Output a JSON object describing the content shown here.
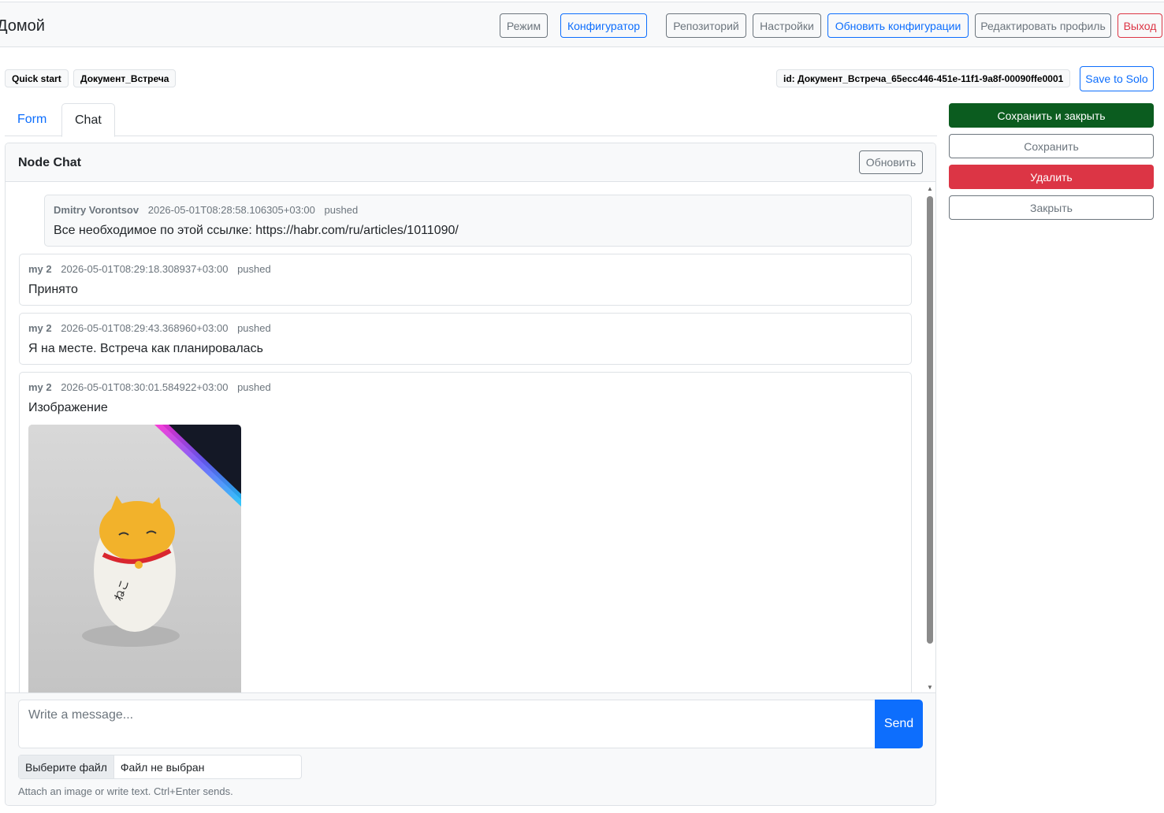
{
  "topbar": {
    "brand": "Домой",
    "buttons": {
      "mode": "Режим",
      "configurator": "Конфигуратор",
      "repository": "Репозиторий",
      "settings": "Настройки",
      "update_configs": "Обновить конфигурации",
      "edit_profile": "Редактировать профиль",
      "logout": "Выход"
    }
  },
  "breadcrumbs": {
    "quick_start": "Quick start",
    "document": "Документ_Встреча",
    "id": "id: Документ_Встреча_65ecc446-451e-11f1-9a8f-00090ffe0001",
    "save_solo": "Save to Solo"
  },
  "tabs": {
    "form": "Form",
    "chat": "Chat"
  },
  "chat": {
    "title": "Node Chat",
    "refresh": "Обновить",
    "messages": [
      {
        "author": "Dmitry Vorontsov",
        "timestamp": "2026-05-01T08:28:58.106305+03:00",
        "status": "pushed",
        "text": "Все необходимое по этой ссылке: https://habr.com/ru/articles/1011090/"
      },
      {
        "author": "my 2",
        "timestamp": "2026-05-01T08:29:18.308937+03:00",
        "status": "pushed",
        "text": "Принято"
      },
      {
        "author": "my 2",
        "timestamp": "2026-05-01T08:29:43.368960+03:00",
        "status": "pushed",
        "text": "Я на месте. Встреча как планировалась"
      },
      {
        "author": "my 2",
        "timestamp": "2026-05-01T08:30:01.584922+03:00",
        "status": "pushed",
        "text": "Изображение"
      }
    ],
    "input_placeholder": "Write a message...",
    "send": "Send",
    "file_button": "Выберите файл",
    "file_status": "Файл не выбран",
    "hint": "Attach an image or write text. Ctrl+Enter sends."
  },
  "sidebar": {
    "save_close": "Сохранить и закрыть",
    "save": "Сохранить",
    "delete": "Удалить",
    "close": "Закрыть"
  },
  "colors": {
    "primary": "#0d6efd",
    "success": "#0b5c1f",
    "danger": "#dc3545",
    "secondary": "#6c757d"
  },
  "icons": {
    "scroll_up": "triangle-up-icon",
    "scroll_down": "triangle-down-icon"
  }
}
